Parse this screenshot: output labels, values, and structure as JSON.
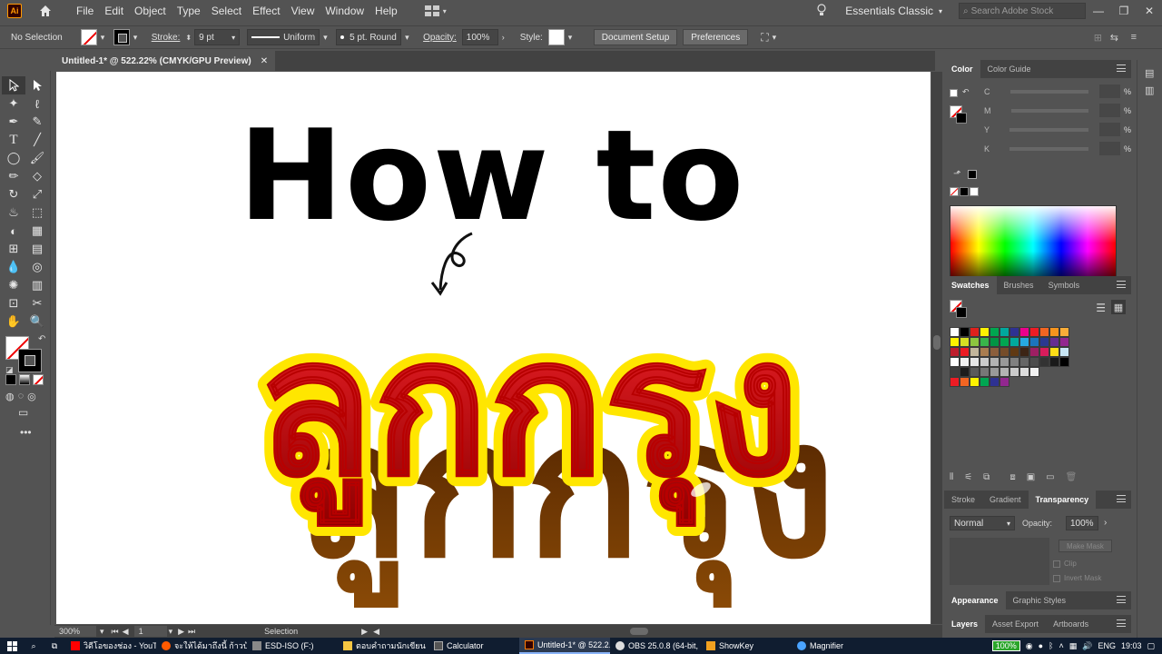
{
  "menubar": {
    "logo": "Ai",
    "items": [
      "File",
      "Edit",
      "Object",
      "Type",
      "Select",
      "Effect",
      "View",
      "Window",
      "Help"
    ],
    "workspace": "Essentials Classic",
    "search_placeholder": "Search Adobe Stock"
  },
  "controlbar": {
    "selection_label": "No Selection",
    "stroke_label": "Stroke:",
    "stroke_value": "9 pt",
    "profile_value": "Uniform",
    "brush_value": "5 pt. Round",
    "opacity_label": "Opacity:",
    "opacity_value": "100%",
    "style_label": "Style:",
    "doc_setup": "Document Setup",
    "preferences": "Preferences"
  },
  "document": {
    "tab_title": "Untitled-1* @ 522.22% (CMYK/GPU Preview)",
    "artwork_text": "How to",
    "thai_text": "ลูกกรุง"
  },
  "statusbar": {
    "zoom": "300%",
    "artboard": "1",
    "tool_status": "Selection"
  },
  "color_panel": {
    "tabs": [
      "Color",
      "Color Guide"
    ],
    "channels": [
      "C",
      "M",
      "Y",
      "K"
    ],
    "pct": "%"
  },
  "swatches_panel": {
    "tabs": [
      "Swatches",
      "Brushes",
      "Symbols"
    ],
    "rows": [
      [
        "#ffffff",
        "#000000",
        "#e0201c",
        "#fff200",
        "#00a650",
        "#00a99d",
        "#2e3192",
        "#ec008c",
        "#ed1c24",
        "#f26522",
        "#f7941d",
        "#f9ad38"
      ],
      [
        "#fff200",
        "#d7df23",
        "#8dc63f",
        "#39b54a",
        "#009444",
        "#00a651",
        "#00a99d",
        "#27aae1",
        "#1c75bc",
        "#2b3990",
        "#662d91",
        "#92278f"
      ],
      [
        "#be1e2d",
        "#ed1c24",
        "#c2b59b",
        "#a97c50",
        "#8b5e3c",
        "#754c29",
        "#603913",
        "#3c2415",
        "#9e1f63",
        "#d91c5c",
        "#ffde17",
        "#c8e6f5"
      ],
      [
        "#ffffff",
        "#f2f2f2",
        "#e6e6e6",
        "#cccccc",
        "#b3b3b3",
        "#999999",
        "#808080",
        "#666666",
        "#4d4d4d",
        "#333333",
        "#1a1a1a",
        "#000000"
      ],
      [
        "#3d3d3d",
        "#1c1c1c",
        "#5a5a5a",
        "#777777",
        "#999999",
        "#b3b3b3",
        "#cccccc",
        "#dddddd",
        "#f2f2f2"
      ],
      [
        "#ed1c24",
        "#f26522",
        "#fff200",
        "#00a651",
        "#2e3192",
        "#92278f"
      ]
    ]
  },
  "stroke_panel": {
    "tabs": [
      "Stroke",
      "Gradient",
      "Transparency"
    ],
    "blend_mode": "Normal",
    "opacity_label": "Opacity:",
    "opacity_value": "100%",
    "make_mask": "Make Mask",
    "clip": "Clip",
    "invert_mask": "Invert Mask"
  },
  "appearance_panel": {
    "tabs": [
      "Appearance",
      "Graphic Styles"
    ]
  },
  "layers_panel": {
    "tabs": [
      "Layers",
      "Asset Export",
      "Artboards"
    ]
  },
  "taskbar": {
    "items": [
      {
        "label": "วิดีโอของช่อง - YouTu...",
        "color": "#ff0000"
      },
      {
        "label": "จะให้ได้มาถึงนี้ ก้าวบ้าท...",
        "color": "#ff5a00"
      },
      {
        "label": "ESD-ISO (F:)",
        "color": "#f5c542"
      },
      {
        "label": "ตอบคำถามนักเขียน",
        "color": "#f5c542"
      },
      {
        "label": "Calculator",
        "color": "#555555"
      },
      {
        "label": "Untitled-1* @ 522.2...",
        "color": "#ff7c00"
      },
      {
        "label": "OBS 25.0.8 (64-bit, ...",
        "color": "#dddddd"
      },
      {
        "label": "ShowKey",
        "color": "#f0a020"
      },
      {
        "label": "Magnifier",
        "color": "#4aa3ff"
      }
    ],
    "battery": "100%",
    "lang": "ENG",
    "time": "19:03"
  }
}
